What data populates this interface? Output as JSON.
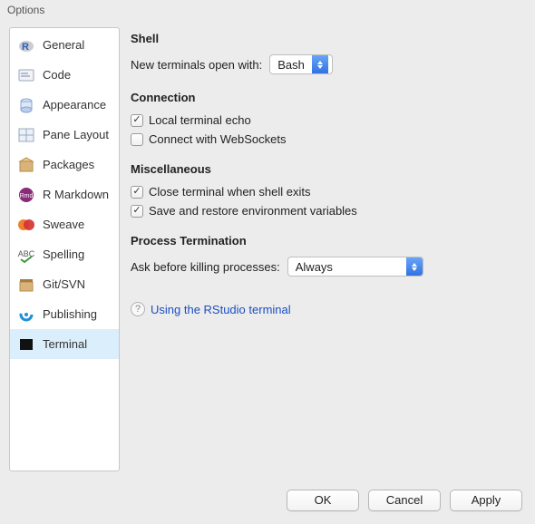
{
  "window": {
    "title": "Options"
  },
  "sidebar": {
    "items": [
      {
        "label": "General"
      },
      {
        "label": "Code"
      },
      {
        "label": "Appearance"
      },
      {
        "label": "Pane Layout"
      },
      {
        "label": "Packages"
      },
      {
        "label": "R Markdown"
      },
      {
        "label": "Sweave"
      },
      {
        "label": "Spelling"
      },
      {
        "label": "Git/SVN"
      },
      {
        "label": "Publishing"
      },
      {
        "label": "Terminal"
      }
    ],
    "selected_index": 10
  },
  "sections": {
    "shell": {
      "heading": "Shell",
      "open_with_label": "New terminals open with:",
      "open_with_value": "Bash"
    },
    "connection": {
      "heading": "Connection",
      "local_echo": {
        "label": "Local terminal echo",
        "checked": true
      },
      "websockets": {
        "label": "Connect with WebSockets",
        "checked": false
      }
    },
    "misc": {
      "heading": "Miscellaneous",
      "close_on_exit": {
        "label": "Close terminal when shell exits",
        "checked": true
      },
      "save_env": {
        "label": "Save and restore environment variables",
        "checked": true
      }
    },
    "termination": {
      "heading": "Process Termination",
      "ask_label": "Ask before killing processes:",
      "ask_value": "Always"
    }
  },
  "help": {
    "label": "Using the RStudio terminal"
  },
  "buttons": {
    "ok": "OK",
    "cancel": "Cancel",
    "apply": "Apply"
  }
}
